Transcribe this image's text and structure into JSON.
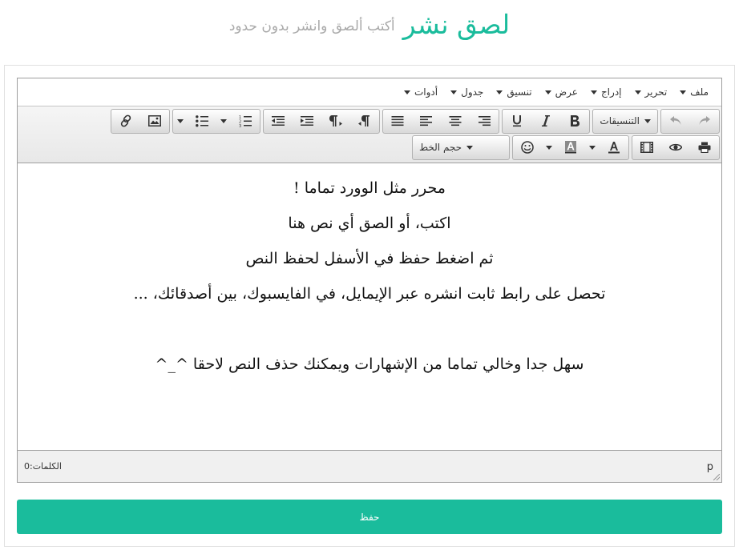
{
  "header": {
    "logo": "لصق نشر",
    "tagline": "أكتب ألصق وانشر بدون حدود"
  },
  "menubar": {
    "items": [
      "ملف",
      "تحرير",
      "إدراج",
      "عرض",
      "تنسيق",
      "جدول",
      "أدوات"
    ]
  },
  "toolbar": {
    "styles_label": "التنسيقات",
    "font_size_label": "حجم الخط"
  },
  "content": {
    "lines": [
      "محرر مثل الوورد تماما !",
      "اكتب، أو الصق أي نص هنا",
      "ثم اضغط حفظ في الأسفل لحفظ النص",
      "تحصل على رابط ثابت انشره عبر الإيمايل، في الفايسبوك، بين أصدقائك، ...",
      "",
      "سهل جدا وخالي تماما من الإشهارات ويمكنك حذف النص لاحقا  ^_^"
    ]
  },
  "statusbar": {
    "path": "p",
    "wordcount_label": "الكلمات:",
    "wordcount_value": "0"
  },
  "save_button": {
    "label": "حفظ"
  },
  "colors": {
    "accent": "#1abc9c"
  }
}
